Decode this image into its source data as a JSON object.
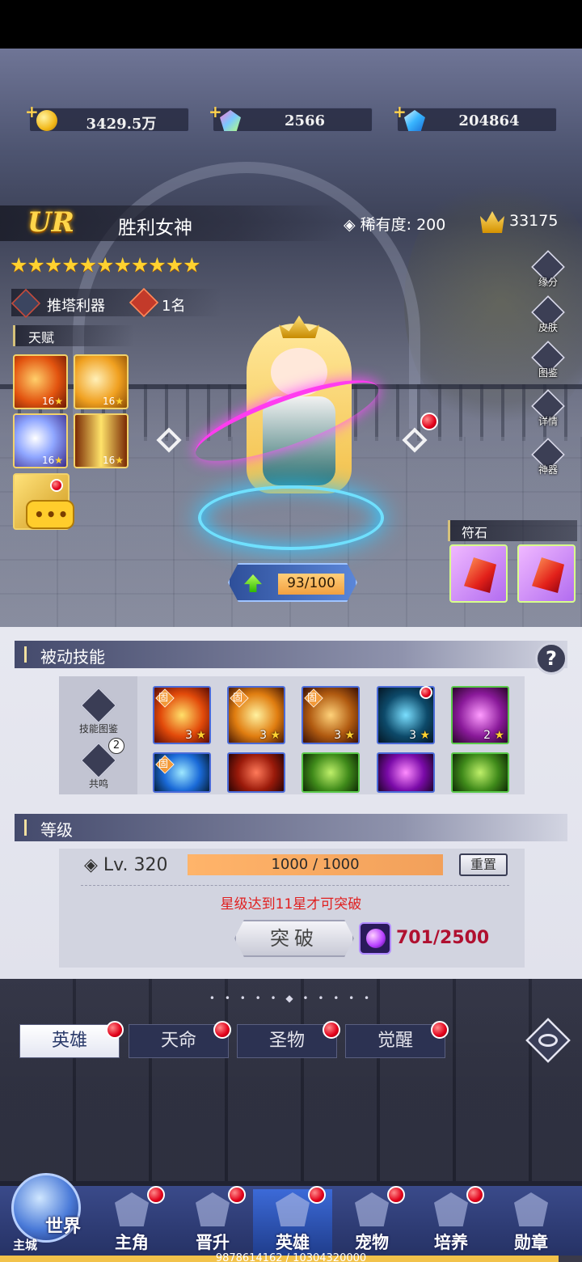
{
  "resources": {
    "gold": "3429.5万",
    "crystal": "2566",
    "diamond": "204864",
    "plus": "+"
  },
  "hero": {
    "grade": "UR",
    "name": "胜利女神",
    "rarity": "稀有度:  200",
    "power": "33175",
    "stars": "★★★★★★★★★★★",
    "tag_label": "推塔利器",
    "rank": "1名",
    "exp": "93/100"
  },
  "talents": {
    "title": "天赋",
    "items": [
      {
        "level": "16"
      },
      {
        "level": "16"
      },
      {
        "level": "16"
      },
      {
        "level": "16"
      }
    ],
    "chat_dots": "•••"
  },
  "side_buttons": [
    "缘分",
    "皮肤",
    "图鉴",
    "详情",
    "神器"
  ],
  "runes": {
    "title": "符石"
  },
  "passive": {
    "title": "被动技能",
    "help": "?",
    "side": {
      "encyclopedia": "技能图鉴",
      "resonance": "共鸣",
      "resonance_count": "2"
    },
    "fixed_tag": "固",
    "row1": [
      {
        "level": "3"
      },
      {
        "level": "3"
      },
      {
        "level": "3"
      },
      {
        "level": "3"
      },
      {
        "level": "2"
      }
    ]
  },
  "level": {
    "title": "等级",
    "label": "Lv. 320",
    "exp": "1000 / 1000",
    "reset": "重置",
    "warning": "星级达到11星才可突破",
    "break_label": "突破",
    "break_cost": "701/2500"
  },
  "tabs": [
    "英雄",
    "天命",
    "圣物",
    "觉醒"
  ],
  "divider": "• • • • • ◆ • • • • •",
  "nav": {
    "world": "世界",
    "home": "主城",
    "items": [
      "主角",
      "晋升",
      "英雄",
      "宠物",
      "培养",
      "勋章"
    ]
  },
  "footer": "9878614162 / 10304320000",
  "colors": {
    "accent_gold": "#ffd230",
    "warning_red": "#e02020",
    "tab_active": "#2a3a6a"
  }
}
